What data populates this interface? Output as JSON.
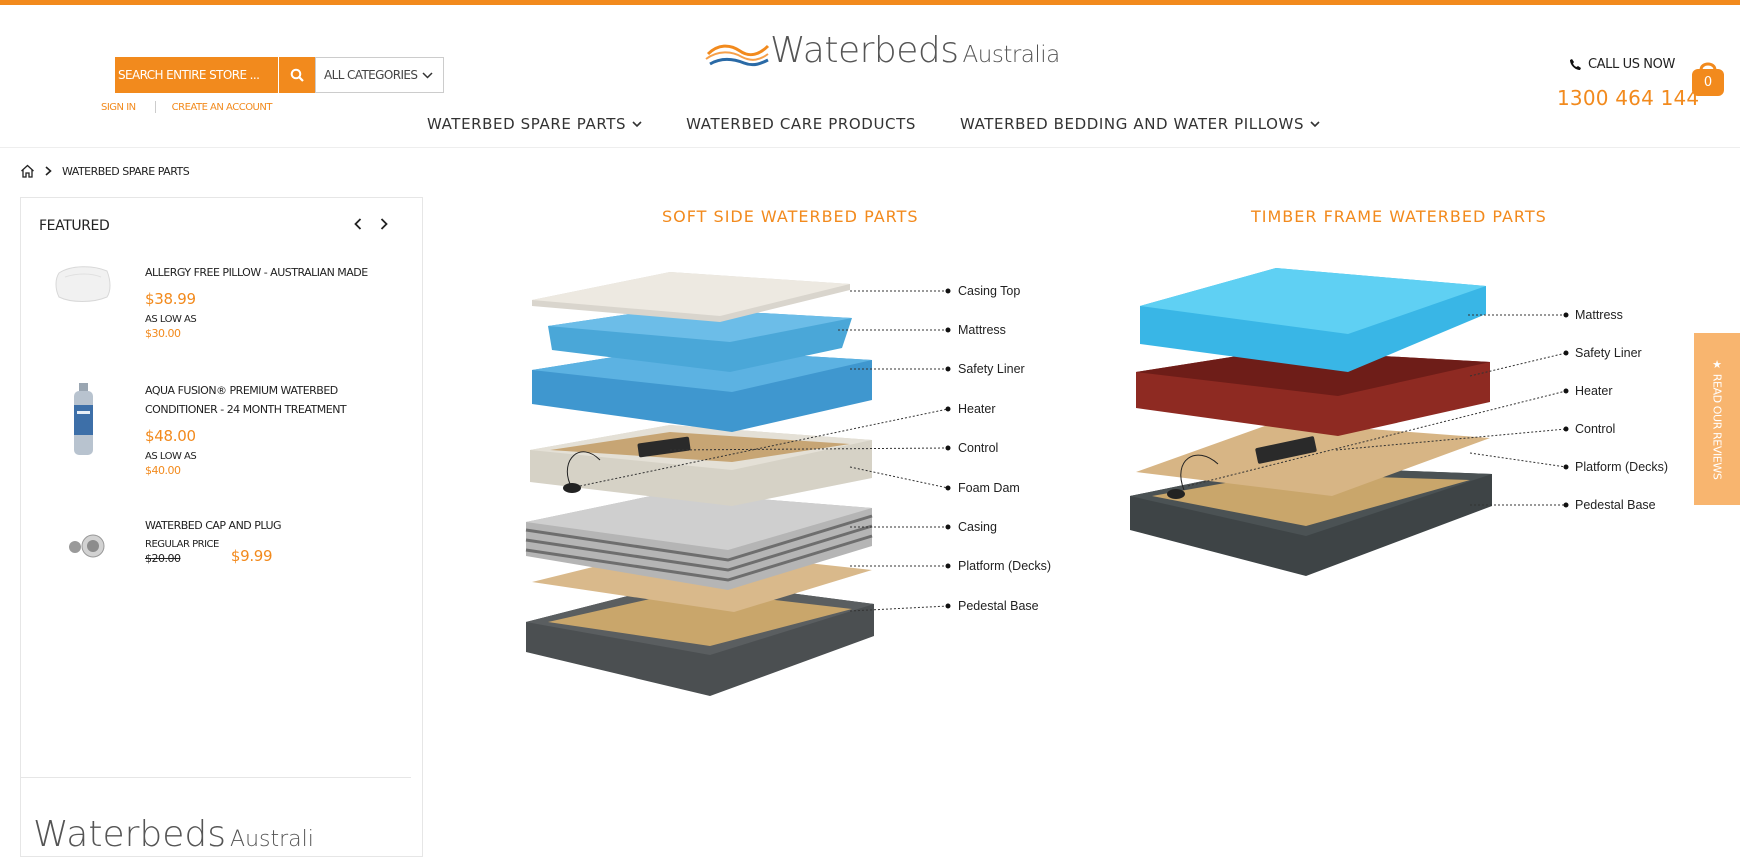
{
  "header": {
    "search_placeholder": "SEARCH ENTIRE STORE ...",
    "category_select": "ALL CATEGORIES",
    "sign_in": "SIGN IN",
    "create_account": "CREATE AN ACCOUNT",
    "logo_main": "Waterbeds",
    "logo_sub": "Australia",
    "call_label": "CALL US NOW",
    "phone": "1300 464 144",
    "cart_count": "0"
  },
  "nav": {
    "items": [
      {
        "label": "WATERBED SPARE PARTS",
        "has_dropdown": true
      },
      {
        "label": "WATERBED CARE PRODUCTS",
        "has_dropdown": false
      },
      {
        "label": "WATERBED BEDDING AND WATER PILLOWS",
        "has_dropdown": true
      }
    ]
  },
  "breadcrumb": {
    "current": "WATERBED SPARE PARTS"
  },
  "sidebar": {
    "title": "FEATURED",
    "products": [
      {
        "name": "ALLERGY FREE PILLOW - AUSTRALIAN MADE",
        "price": "$38.99",
        "low_label": "AS LOW AS",
        "low_price": "$30.00"
      },
      {
        "name": "AQUA FUSION® PREMIUM WATERBED CONDITIONER - 24 MONTH TREATMENT",
        "price": "$48.00",
        "low_label": "AS LOW AS",
        "low_price": "$40.00"
      },
      {
        "name": "WATERBED CAP AND PLUG",
        "regular_label": "REGULAR PRICE",
        "old_price": "$20.00",
        "price": "$9.99"
      }
    ],
    "logo_main": "Waterbeds",
    "logo_sub": "Australi"
  },
  "diagrams": {
    "soft_side": {
      "title": "SOFT SIDE WATERBED PARTS",
      "labels": [
        "Casing Top",
        "Mattress",
        "Safety Liner",
        "Heater",
        "Control",
        "Foam Dam",
        "Casing",
        "Platform (Decks)",
        "Pedestal Base"
      ]
    },
    "timber_frame": {
      "title": "TIMBER FRAME WATERBED PARTS",
      "labels": [
        "Mattress",
        "Safety Liner",
        "Heater",
        "Control",
        "Platform (Decks)",
        "Pedestal Base"
      ]
    }
  },
  "reviews_tab": "★ READ OUR REVIEWS",
  "colors": {
    "accent": "#f28a1d",
    "mattress_blue": "#4aa7d8",
    "liner_red": "#8e2a22",
    "base_grey": "#4b4f51"
  }
}
